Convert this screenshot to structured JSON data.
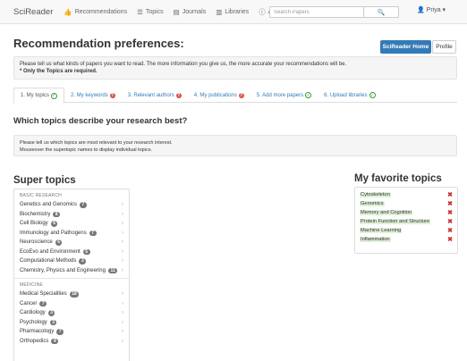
{
  "navbar": {
    "brand": "SciReader",
    "links": [
      {
        "icon": "thumbs-up-icon",
        "glyph": "👍",
        "label": "Recommendations"
      },
      {
        "icon": "list-icon",
        "glyph": "☰",
        "label": "Topics"
      },
      {
        "icon": "book-icon",
        "glyph": "▤",
        "label": "Journals"
      },
      {
        "icon": "library-icon",
        "glyph": "▥",
        "label": "Libraries"
      },
      {
        "icon": "info-icon",
        "glyph": "ⓘ",
        "label": "About"
      }
    ],
    "search_placeholder": "Search Papers",
    "search_icon": "🔍",
    "user": "👤 Priya ▾"
  },
  "header": {
    "title": "Recommendation preferences:",
    "home_button": "SciReader Home",
    "profile_button": "Profile"
  },
  "info": {
    "line1": "Please tell us what kinds of papers you want to read. The more information you give us, the more accurate your recommendations will be.",
    "line2": "* Only the Topics are required."
  },
  "tabs": [
    {
      "label": "1. My topics",
      "status": "ok",
      "active": true
    },
    {
      "label": "2. My keywords",
      "status": "warn",
      "active": false
    },
    {
      "label": "3. Relevant authors",
      "status": "warn",
      "active": false
    },
    {
      "label": "4. My publications",
      "status": "warn",
      "active": false
    },
    {
      "label": "5. Add more papers",
      "status": "ok",
      "active": false
    },
    {
      "label": "6. Upload libraries",
      "status": "ok",
      "active": false
    }
  ],
  "question": {
    "title": "Which topics describe your research best?",
    "line1": "Please tell us which topics are most relevant to your research interest.",
    "line2": "Mouseover the supertopic names to display individual topics."
  },
  "super_topics": {
    "heading": "Super topics",
    "sections": [
      {
        "name": "BASIC RESEARCH",
        "items": [
          {
            "label": "Genetics and Genomics",
            "count": "7"
          },
          {
            "label": "Biochemistry",
            "count": "8"
          },
          {
            "label": "Cell Biology",
            "count": "6"
          },
          {
            "label": "Immunology and Pathogens",
            "count": "7"
          },
          {
            "label": "Neuroscience",
            "count": "6"
          },
          {
            "label": "EcoEvo and Environment",
            "count": "5"
          },
          {
            "label": "Computational Methods",
            "count": "3"
          },
          {
            "label": "Chemistry, Physics and Engineering",
            "count": "11"
          }
        ]
      },
      {
        "name": "MEDICINE",
        "items": [
          {
            "label": "Medical Specialities",
            "count": "18"
          },
          {
            "label": "Cancer",
            "count": "7"
          },
          {
            "label": "Cardiology",
            "count": "3"
          },
          {
            "label": "Psychology",
            "count": "3"
          },
          {
            "label": "Pharmacology",
            "count": "7"
          },
          {
            "label": "Orthopedics",
            "count": "4"
          }
        ]
      }
    ]
  },
  "favorites": {
    "heading": "My favorite topics",
    "items": [
      "Cytoskeleton",
      "Genomics",
      "Memory and Cognition",
      "Protein Function and Structure",
      "Machine Learning",
      "Inflammation"
    ],
    "remove_glyph": "✖"
  },
  "colors": {
    "primary": "#337ab7",
    "success": "#3c9a3c",
    "danger": "#d9534f",
    "highlight": "#dff0d8"
  }
}
